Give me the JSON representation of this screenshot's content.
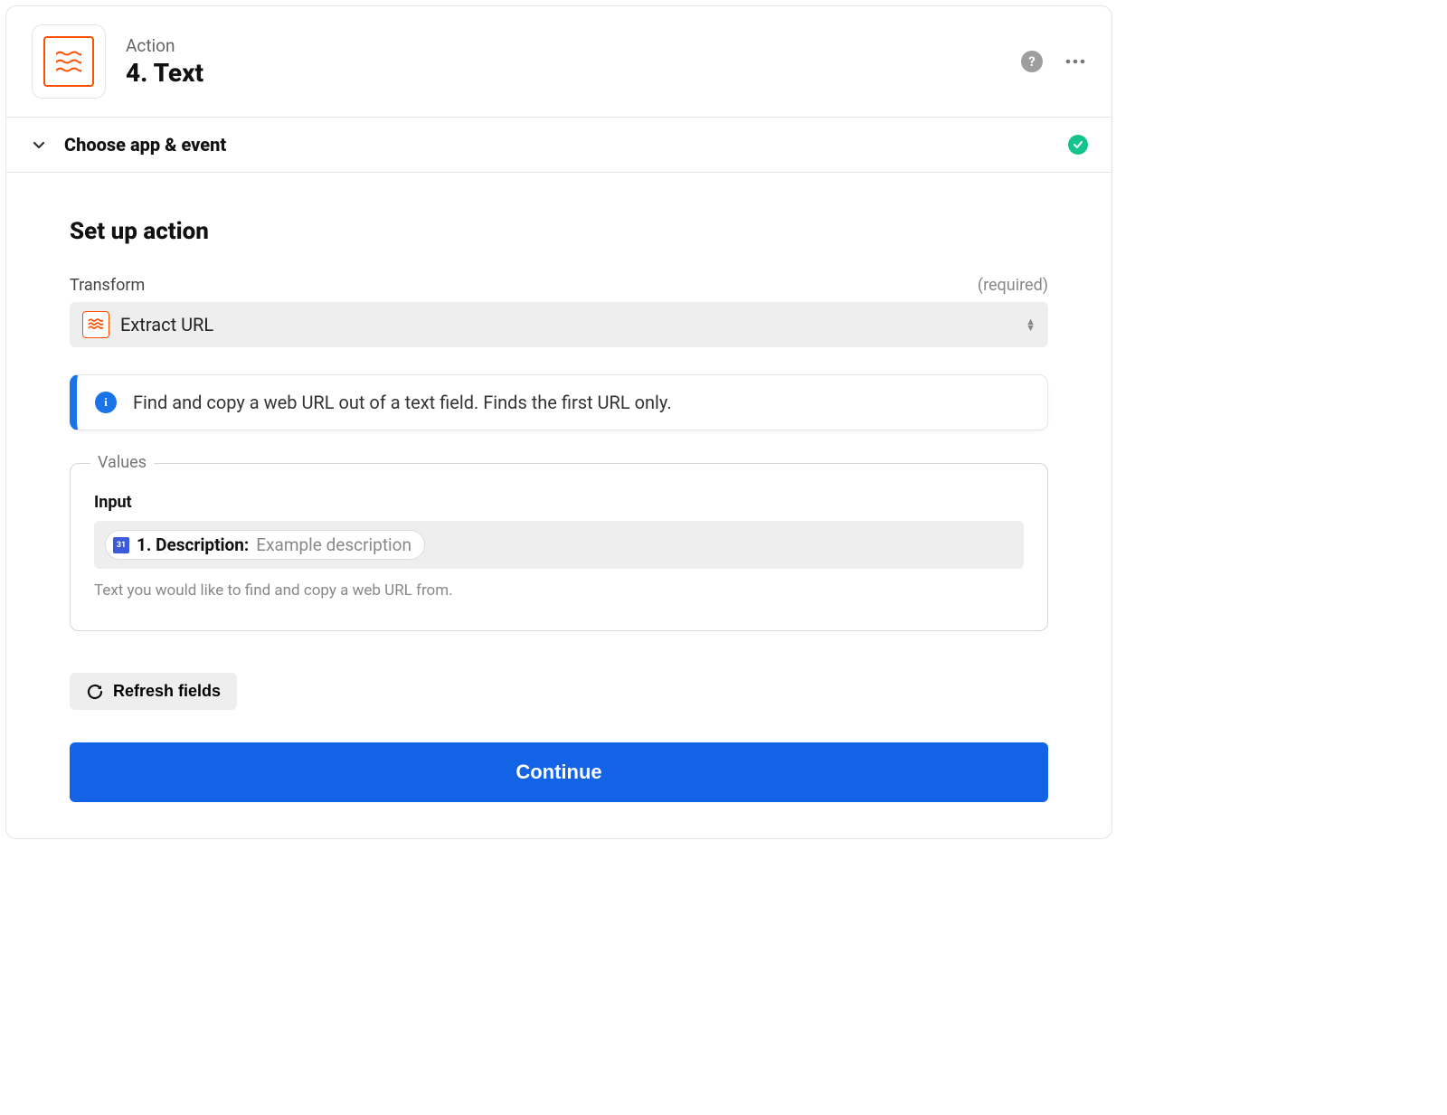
{
  "header": {
    "overline": "Action",
    "title": "4. Text"
  },
  "section": {
    "choose_label": "Choose app & event"
  },
  "body": {
    "heading": "Set up action",
    "transform": {
      "label": "Transform",
      "required": "(required)",
      "value": "Extract URL"
    },
    "info": "Find and copy a web URL out of a text field. Finds the first URL only.",
    "values": {
      "legend": "Values",
      "input_label": "Input",
      "pill_strong": "1. Description:",
      "pill_light": "Example description",
      "help": "Text you would like to find and copy a web URL from."
    },
    "refresh_label": "Refresh fields",
    "continue_label": "Continue"
  }
}
